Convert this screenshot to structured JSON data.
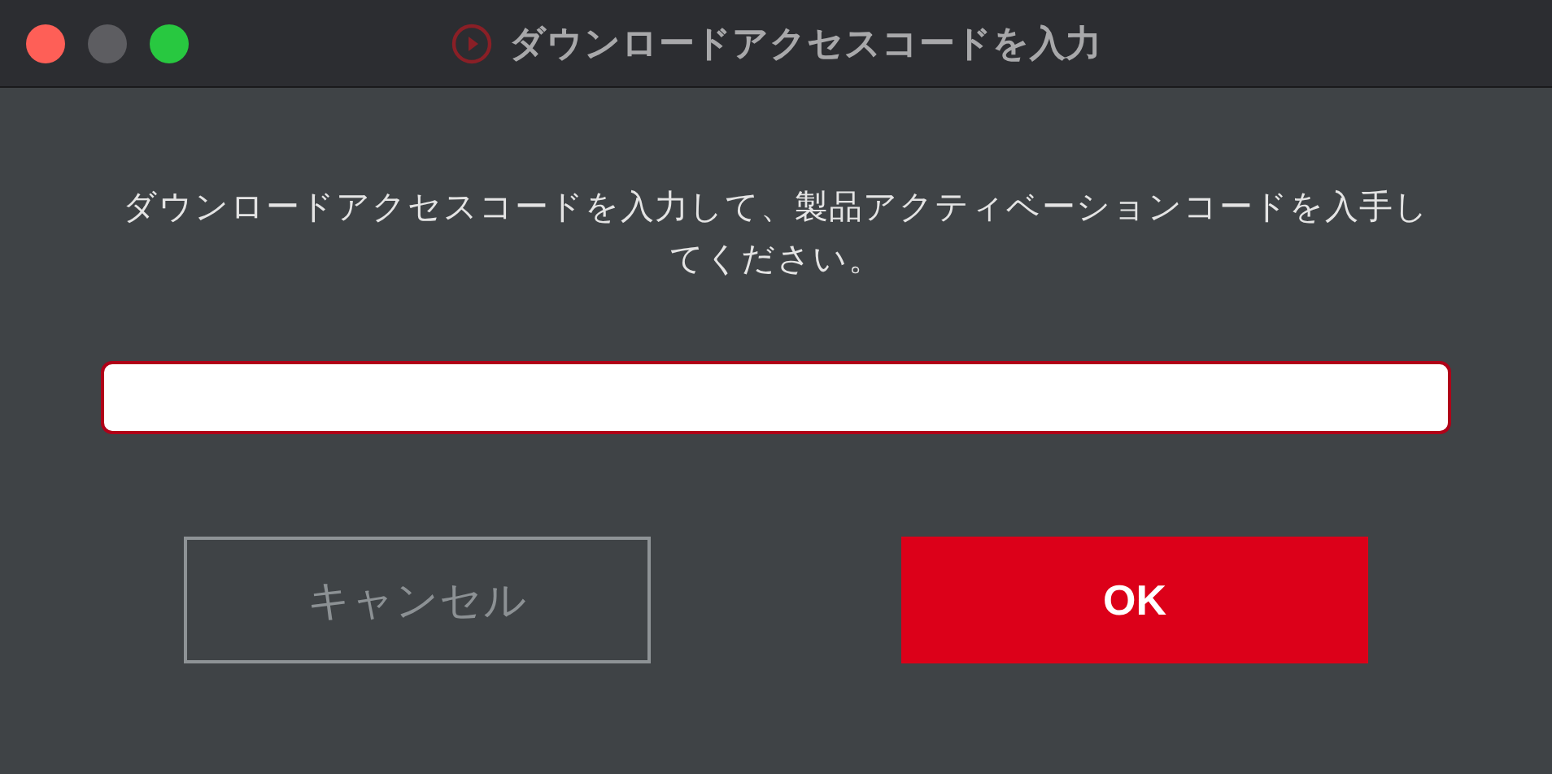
{
  "window": {
    "title": "ダウンロードアクセスコードを入力"
  },
  "message": "ダウンロードアクセスコードを入力して、製品アクティベーションコードを入手してください。",
  "buttons": [
    {
      "kind": "secondary",
      "label": "キャンセル"
    },
    {
      "kind": "primary",
      "label": "OK"
    }
  ]
}
